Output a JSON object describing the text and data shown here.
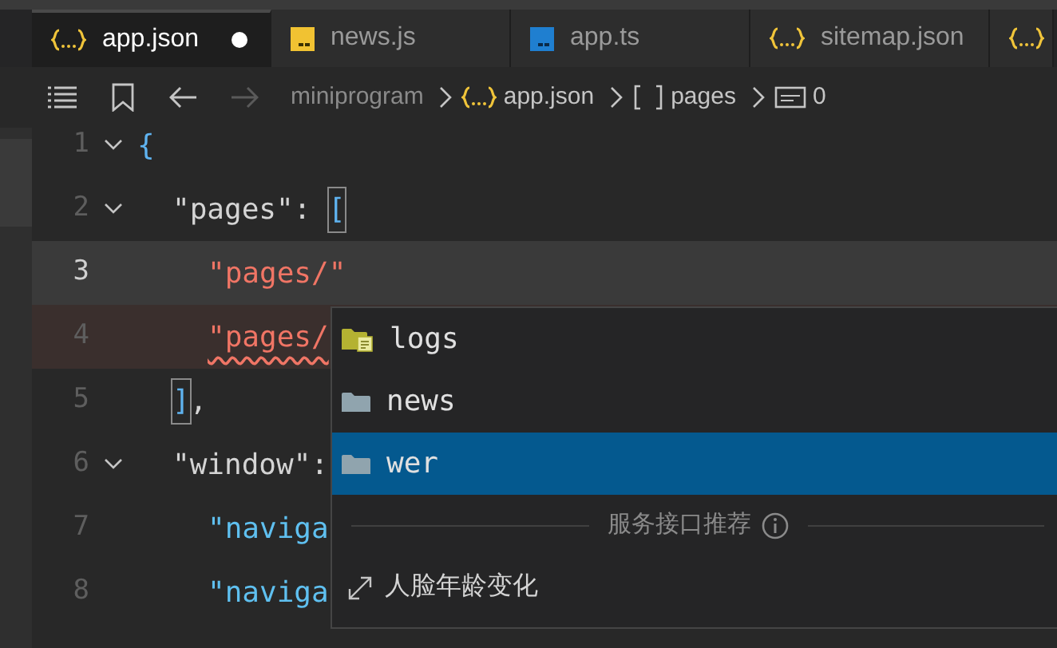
{
  "tabs": [
    {
      "label": "app.json",
      "kind": "json",
      "selected": true,
      "modified": true
    },
    {
      "label": "news.js",
      "kind": "js",
      "selected": false
    },
    {
      "label": "app.ts",
      "kind": "ts",
      "selected": false
    },
    {
      "label": "sitemap.json",
      "kind": "json",
      "selected": false
    },
    {
      "kind": "json",
      "selected": false
    }
  ],
  "breadcrumb": [
    {
      "label": "miniprogram",
      "kind": "folder"
    },
    {
      "label": "app.json",
      "kind": "json"
    },
    {
      "label": "pages",
      "kind": "array"
    },
    {
      "label": "0",
      "kind": "string"
    }
  ],
  "code_lines": [
    {
      "number": "1",
      "current": false,
      "error": false,
      "foldable": true,
      "tokens": [
        {
          "text": "{",
          "kind": "brace"
        }
      ],
      "children": [
        {
          "number": "2",
          "current": false,
          "error": false,
          "foldable": true,
          "tokens": [
            {
              "text": "\"pages\"",
              "kind": "key"
            },
            {
              "text": ": ",
              "kind": "punct"
            },
            {
              "text": "[",
              "kind": "bracket_match"
            }
          ],
          "children": [
            {
              "number": "3",
              "current": true,
              "error": false,
              "foldable": false,
              "tokens": [
                {
                  "text": "\"pages/\"",
                  "kind": "string"
                }
              ]
            },
            {
              "number": "4",
              "current": false,
              "error": true,
              "foldable": false,
              "tokens": [
                {
                  "text": "\"pages/",
                  "kind": "string_error"
                }
              ]
            }
          ]
        },
        {
          "number": "5",
          "current": false,
          "error": false,
          "foldable": false,
          "tokens": [
            {
              "text": "]",
              "kind": "bracket_match"
            },
            {
              "text": ",",
              "kind": "punct"
            }
          ]
        },
        {
          "number": "6",
          "current": false,
          "error": false,
          "foldable": true,
          "tokens": [
            {
              "text": "\"window\"",
              "kind": "key"
            },
            {
              "text": ":",
              "kind": "punct"
            }
          ],
          "children": [
            {
              "number": "7",
              "current": false,
              "error": false,
              "foldable": false,
              "tokens": [
                {
                  "text": "\"naviga",
                  "kind": "key_blue"
                }
              ]
            },
            {
              "number": "8",
              "current": false,
              "error": false,
              "foldable": false,
              "tokens": [
                {
                  "text": "\"naviga",
                  "kind": "key_blue"
                }
              ]
            }
          ]
        }
      ]
    }
  ],
  "suggestions": {
    "items": [
      {
        "label": "logs",
        "kind": "folder_file",
        "selected": false
      },
      {
        "label": "news",
        "kind": "folder",
        "selected": false
      },
      {
        "label": "wer",
        "kind": "folder",
        "selected": true
      }
    ],
    "section_title": "服务接口推荐",
    "services": [
      {
        "label": "人脸年龄变化"
      }
    ]
  }
}
